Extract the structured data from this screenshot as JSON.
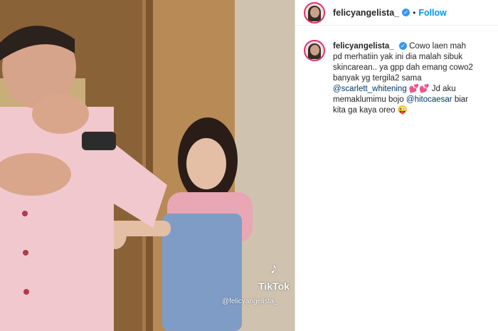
{
  "post": {
    "username": "felicyangelista_",
    "follow_label": "Follow",
    "separator": "•",
    "verified_glyph": "✓",
    "caption_parts": {
      "p1": "Cowo laen mah pd merhatiin yak ini dia malah sibuk skincarean.. ya gpp dah emang cowo2 banyak yg tergila2 sama ",
      "mention1": "@scarlett_whitening",
      "p2": " 💕💕 Jd aku memaklumimu bojo ",
      "mention2": "@hitocaesar",
      "p3": " biar kita ga kaya oreo 😜"
    }
  },
  "video": {
    "tiktok_logo": "♪",
    "tiktok_name": "TikTok",
    "watermark_handle": "@felicyangelista_"
  },
  "colors": {
    "accent": "#0095f6",
    "verified": "#3897f0",
    "text": "#262626",
    "mention": "#00376b"
  }
}
